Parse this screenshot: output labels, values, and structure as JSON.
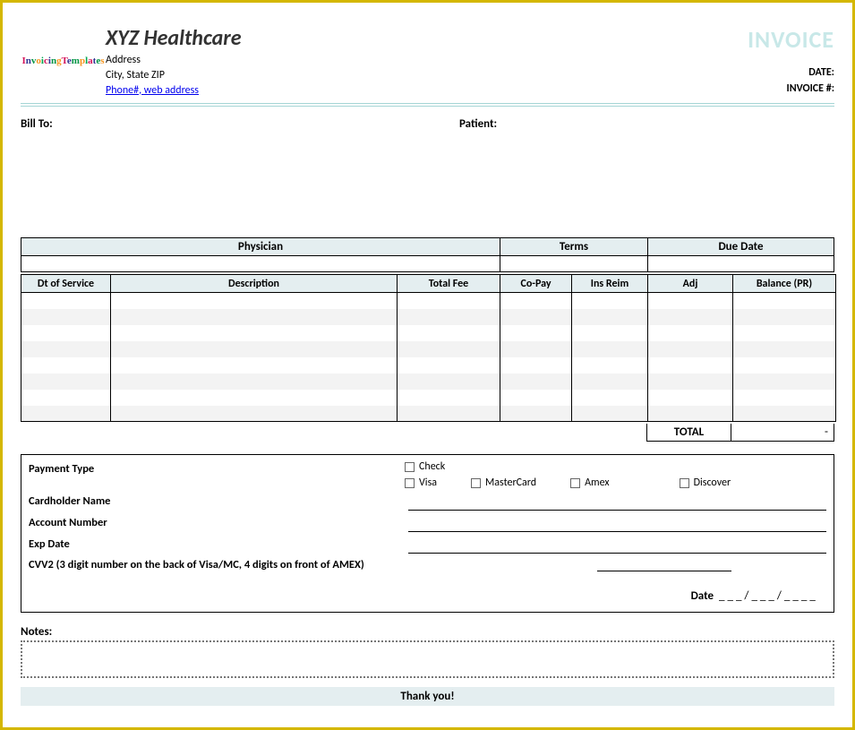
{
  "brand": {
    "logo_text": "InvoicingTemplates"
  },
  "company": {
    "name": "XYZ Healthcare",
    "address_line": "Address",
    "city_state_zip": "City, State ZIP",
    "contact_link": "Phone#, web address"
  },
  "header": {
    "invoice_word": "INVOICE",
    "date_label": "DATE:",
    "invoice_num_label": "INVOICE #:"
  },
  "parties": {
    "bill_to_label": "Bill To:",
    "patient_label": "Patient:"
  },
  "table1_headers": {
    "physician": "Physician",
    "terms": "Terms",
    "due_date": "Due Date"
  },
  "table2_headers": {
    "dt_service": "Dt of Service",
    "description": "Description",
    "total_fee": "Total Fee",
    "co_pay": "Co-Pay",
    "ins_reim": "Ins Reim",
    "adj": "Adj",
    "balance_pr": "Balance (PR)"
  },
  "totals": {
    "label": "TOTAL",
    "value": "-"
  },
  "payment": {
    "type_label": "Payment Type",
    "cardholder_label": "Cardholder Name",
    "account_label": "Account Number",
    "exp_label": "Exp Date",
    "cvv_label": "CVV2 (3 digit number on the back of Visa/MC, 4 digits on front of AMEX)",
    "check": "Check",
    "visa": "Visa",
    "mastercard": "MasterCard",
    "amex": "Amex",
    "discover": "Discover",
    "date_label": "Date",
    "date_slots": "___/___/____"
  },
  "notes": {
    "label": "Notes:"
  },
  "footer": {
    "thanks": "Thank you!"
  }
}
